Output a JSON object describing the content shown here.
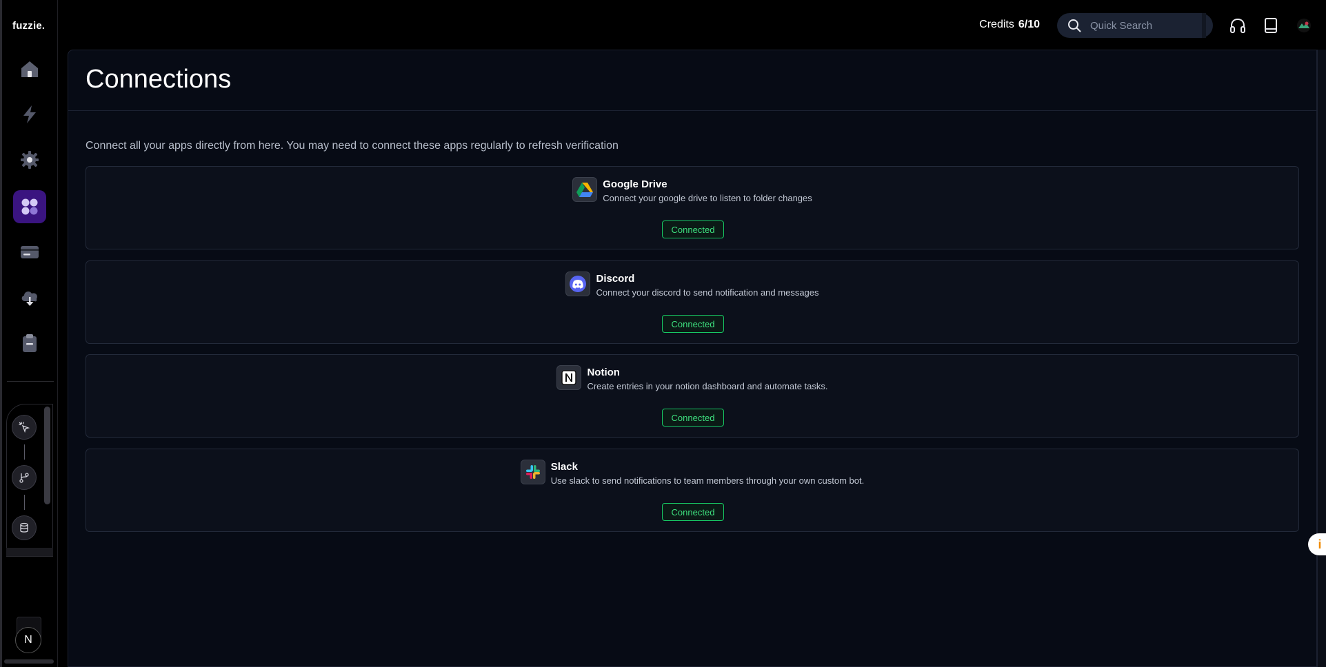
{
  "app": {
    "logo": "fuzzie."
  },
  "sidebar": {
    "items": [
      {
        "name": "home",
        "icon": "home-icon",
        "active": false
      },
      {
        "name": "workflows",
        "icon": "lightning-icon",
        "active": false
      },
      {
        "name": "settings",
        "icon": "gear-icon",
        "active": false
      },
      {
        "name": "connections",
        "icon": "grid-icon",
        "active": true
      },
      {
        "name": "billing",
        "icon": "card-icon",
        "active": false
      },
      {
        "name": "templates",
        "icon": "cloud-download-icon",
        "active": false
      },
      {
        "name": "logs",
        "icon": "clipboard-icon",
        "active": false
      }
    ],
    "flow_nodes": [
      "cursor-click-icon",
      "git-branch-icon",
      "database-icon"
    ],
    "user_initial": "N"
  },
  "topbar": {
    "credits_label": "Credits",
    "credits_value": "6/10",
    "search_placeholder": "Quick Search",
    "icons": [
      "headphones-icon",
      "book-icon",
      "user-avatar-icon"
    ]
  },
  "page": {
    "title": "Connections",
    "description": "Connect all your apps directly from here. You may need to connect these apps regularly to refresh verification"
  },
  "connections": [
    {
      "name": "Google Drive",
      "description": "Connect your google drive to listen to folder changes",
      "status": "Connected",
      "icon": "google-drive-icon"
    },
    {
      "name": "Discord",
      "description": "Connect your discord to send notification and messages",
      "status": "Connected",
      "icon": "discord-icon"
    },
    {
      "name": "Notion",
      "description": "Create entries in your notion dashboard and automate tasks.",
      "status": "Connected",
      "icon": "notion-icon"
    },
    {
      "name": "Slack",
      "description": "Use slack to send notifications to team members through your own custom bot.",
      "status": "Connected",
      "icon": "slack-icon"
    }
  ],
  "colors": {
    "accent": "#3a1480",
    "connected": "#17c964",
    "panel_bg": "#070b15"
  }
}
